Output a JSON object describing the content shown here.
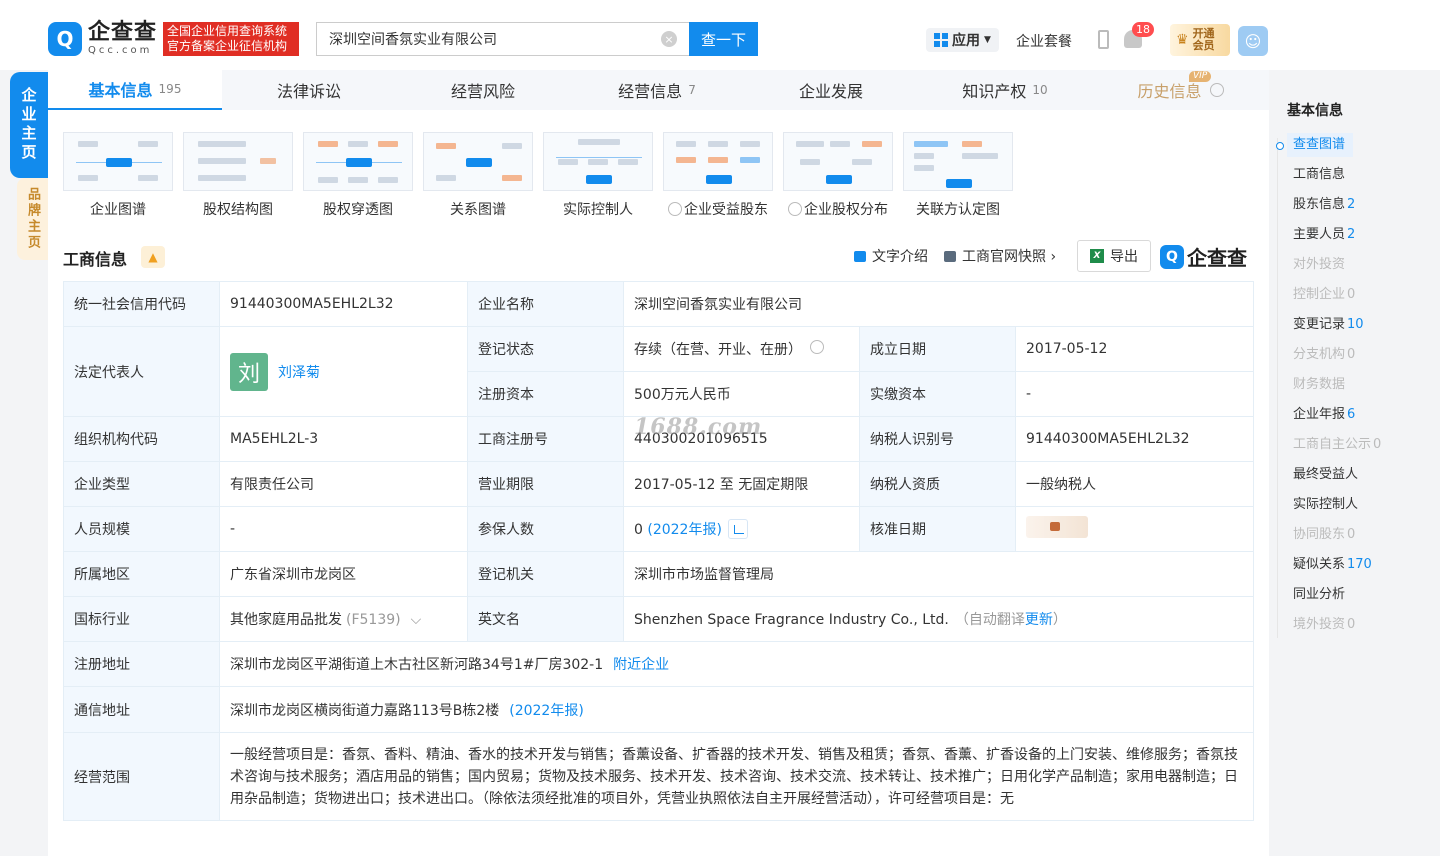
{
  "header": {
    "logo_mark": "Q",
    "logo_cn": "企查查",
    "logo_en": "Qcc.com",
    "slogan_line1": "全国企业信用查询系统",
    "slogan_line2": "官方备案企业征信机构",
    "search_value": "深圳空间香氛实业有限公司",
    "search_button": "查一下",
    "apps_label": "应用",
    "suite_label": "企业套餐",
    "notification_count": "18",
    "vip_line1": "开通",
    "vip_line2": "会员"
  },
  "side": {
    "tab_main": "企业主页",
    "tab_brand": "品牌主页"
  },
  "tabs": [
    {
      "label": "基本信息",
      "count": "195"
    },
    {
      "label": "法律诉讼",
      "count": ""
    },
    {
      "label": "经营风险",
      "count": ""
    },
    {
      "label": "经营信息",
      "count": "7"
    },
    {
      "label": "企业发展",
      "count": ""
    },
    {
      "label": "知识产权",
      "count": "10"
    },
    {
      "label": "历史信息",
      "count": "",
      "badge": "VIP"
    }
  ],
  "cards": [
    "企业图谱",
    "股权结构图",
    "股权穿透图",
    "关系图谱",
    "实际控制人",
    "企业受益股东",
    "企业股权分布",
    "关联方认定图"
  ],
  "section": {
    "title": "工商信息",
    "action_text": "文字介绍",
    "action_snapshot": "工商官网快照",
    "action_export": "导出",
    "brand": "企查查"
  },
  "info": {
    "credit_code_k": "统一社会信用代码",
    "credit_code_v": "91440300MA5EHL2L32",
    "name_k": "企业名称",
    "name_v": "深圳空间香氛实业有限公司",
    "rep_k": "法定代表人",
    "rep_avatar": "刘",
    "rep_v": "刘泽菊",
    "status_k": "登记状态",
    "status_v": "存续（在营、开业、在册）",
    "found_k": "成立日期",
    "found_v": "2017-05-12",
    "capital_k": "注册资本",
    "capital_v": "500万元人民币",
    "paid_k": "实缴资本",
    "paid_v": "-",
    "org_k": "组织机构代码",
    "org_v": "MA5EHL2L-3",
    "reg_no_k": "工商注册号",
    "reg_no_v": "440300201096515",
    "tax_k": "纳税人识别号",
    "tax_v": "91440300MA5EHL2L32",
    "type_k": "企业类型",
    "type_v": "有限责任公司",
    "term_k": "营业期限",
    "term_v": "2017-05-12 至 无固定期限",
    "taxq_k": "纳税人资质",
    "taxq_v": "一般纳税人",
    "staff_k": "人员规模",
    "staff_v": "-",
    "insured_k": "参保人数",
    "insured_v": "0",
    "insured_note": "(2022年报)",
    "approve_k": "核准日期",
    "region_k": "所属地区",
    "region_v": "广东省深圳市龙岗区",
    "authority_k": "登记机关",
    "authority_v": "深圳市市场监督管理局",
    "industry_k": "国标行业",
    "industry_v": "其他家庭用品批发",
    "industry_code": "(F5139)",
    "en_k": "英文名",
    "en_v": "Shenzhen Space Fragrance Industry Co., Ltd.",
    "en_note_pre": "（自动翻译",
    "en_note_link": "更新",
    "en_note_post": "）",
    "addr_k": "注册地址",
    "addr_v": "深圳市龙岗区平湖街道上木古社区新河路34号1#厂房302-1",
    "addr_link": "附近企业",
    "mail_k": "通信地址",
    "mail_v": "深圳市龙岗区横岗街道力嘉路113号B栋2楼",
    "mail_note": "(2022年报)",
    "scope_k": "经营范围",
    "scope_v": "一般经营项目是：香氛、香料、精油、香水的技术开发与销售；香薰设备、扩香器的技术开发、销售及租赁；香氛、香薰、扩香设备的上门安装、维修服务；香氛技术咨询与技术服务；酒店用品的销售；国内贸易；货物及技术服务、技术开发、技术咨询、技术交流、技术转让、技术推广；日用化学产品制造；家用电器制造；日用杂品制造；货物进出口；技术进出口。（除依法须经批准的项目外，凭营业执照依法自主开展经营活动），许可经营项目是：无"
  },
  "watermark": "1688.com",
  "right_nav": {
    "title": "基本信息",
    "items": [
      {
        "label": "查查图谱",
        "count": "",
        "state": "on"
      },
      {
        "label": "工商信息",
        "count": "",
        "state": ""
      },
      {
        "label": "股东信息",
        "count": "2",
        "state": ""
      },
      {
        "label": "主要人员",
        "count": "2",
        "state": ""
      },
      {
        "label": "对外投资",
        "count": "",
        "state": "dis"
      },
      {
        "label": "控制企业",
        "count": "0",
        "state": "dis"
      },
      {
        "label": "变更记录",
        "count": "10",
        "state": ""
      },
      {
        "label": "分支机构",
        "count": "0",
        "state": "dis"
      },
      {
        "label": "财务数据",
        "count": "",
        "state": "dis"
      },
      {
        "label": "企业年报",
        "count": "6",
        "state": ""
      },
      {
        "label": "工商自主公示",
        "count": "0",
        "state": "dis"
      },
      {
        "label": "最终受益人",
        "count": "",
        "state": ""
      },
      {
        "label": "实际控制人",
        "count": "",
        "state": ""
      },
      {
        "label": "协同股东",
        "count": "0",
        "state": "dis"
      },
      {
        "label": "疑似关系",
        "count": "170",
        "state": ""
      },
      {
        "label": "同业分析",
        "count": "",
        "state": ""
      },
      {
        "label": "境外投资",
        "count": "0",
        "state": "dis"
      }
    ]
  }
}
